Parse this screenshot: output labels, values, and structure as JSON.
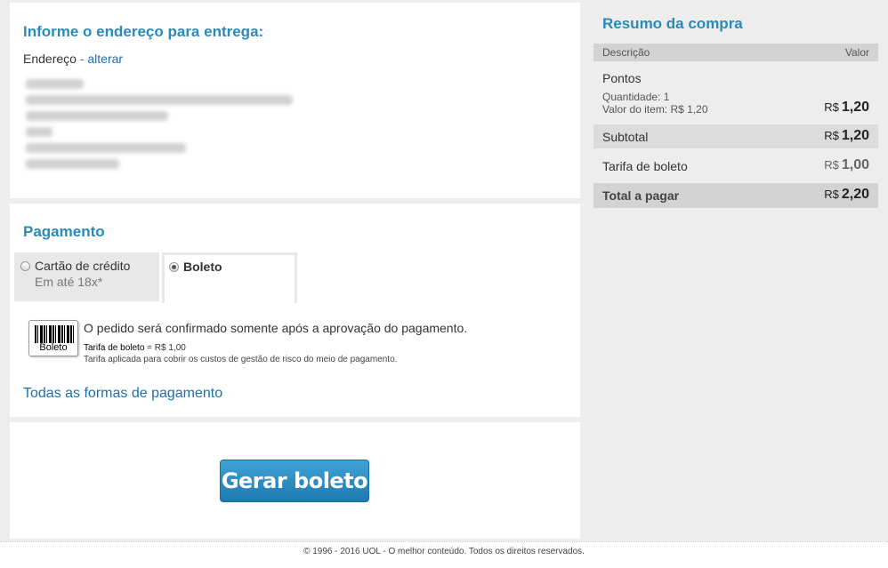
{
  "address": {
    "title": "Informe o endereço para entrega:",
    "label": "Endereço",
    "separator": " - ",
    "change_link": "alterar"
  },
  "payment": {
    "title": "Pagamento",
    "tabs": {
      "credit": {
        "label": "Cartão de crédito",
        "sub": "Em até 18x*",
        "selected": false
      },
      "boleto": {
        "label": "Boleto",
        "selected": true
      }
    },
    "barcode_text": "Boleto",
    "message": "O pedido será confirmado somente após a aprovação do pagamento.",
    "fee_label": "Tarifa de boleto",
    "fee_value": " = R$ 1,00",
    "fee_note": "Tarifa aplicada para cobrir os custos de gestão de risco do meio de pagamento.",
    "all_methods_link": "Todas as formas de pagamento"
  },
  "action": {
    "generate_button": "Gerar boleto"
  },
  "summary": {
    "title": "Resumo da compra",
    "col_desc": "Descrição",
    "col_value": "Valor",
    "item": {
      "name": "Pontos",
      "quantity": "Quantidade: 1",
      "unit_value": "Valor do item: R$ 1,20",
      "currency": "R$",
      "amount": "1,20"
    },
    "subtotal": {
      "label": "Subtotal",
      "currency": "R$",
      "amount": "1,20"
    },
    "fee": {
      "label": "Tarifa de boleto",
      "currency": "R$",
      "amount": "1,00"
    },
    "total": {
      "label": "Total a pagar",
      "currency": "R$",
      "amount": "2,20"
    }
  },
  "footer": {
    "text": "© 1996 - 2016 UOL - O melhor conteúdo. Todos os direitos reservados."
  },
  "colors": {
    "accent": "#2a8ab8",
    "link": "#1f6fa8",
    "button": "#2b8cc4"
  }
}
